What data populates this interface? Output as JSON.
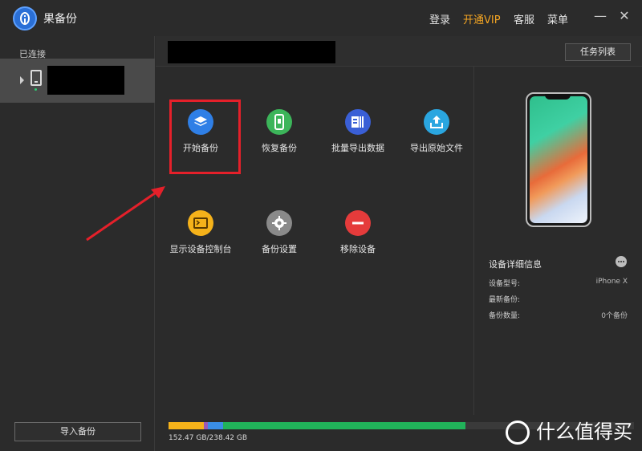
{
  "app": {
    "title": "果备份"
  },
  "topmenu": {
    "login": "登录",
    "vip": "开通VIP",
    "service": "客服",
    "menu": "菜单"
  },
  "sidebar": {
    "heading": "已连接",
    "import_label": "导入备份"
  },
  "header": {
    "task_list_label": "任务列表"
  },
  "functions": [
    {
      "label": "开始备份",
      "icon": "layers-icon",
      "color": "#2f7fe6"
    },
    {
      "label": "恢复备份",
      "icon": "phone-restore-icon",
      "color": "#3cb55a"
    },
    {
      "label": "批量导出数据",
      "icon": "batch-export-icon",
      "color": "#3a5fd6"
    },
    {
      "label": "导出原始文件",
      "icon": "upload-tray-icon",
      "color": "#2aa6e0"
    },
    {
      "label": "显示设备控制台",
      "icon": "console-icon",
      "color": "#f5b21a"
    },
    {
      "label": "备份设置",
      "icon": "gear-icon",
      "color": "#8a8a8a"
    },
    {
      "label": "移除设备",
      "icon": "minus-icon",
      "color": "#e53b3b"
    }
  ],
  "details": {
    "title": "设备详细信息",
    "rows": [
      {
        "label": "设备型号:",
        "value": "iPhone X"
      },
      {
        "label": "最新备份:",
        "value": ""
      },
      {
        "label": "备份数量:",
        "value": "0个备份"
      }
    ]
  },
  "storage": {
    "text": "152.47 GB/238.42 GB",
    "used_fraction": 0.639,
    "segments": [
      {
        "fraction": 0.075,
        "color": "#f5b21a"
      },
      {
        "fraction": 0.01,
        "color": "#9b59b6"
      },
      {
        "fraction": 0.033,
        "color": "#3a8ee6"
      },
      {
        "fraction": 0.521,
        "color": "#21b35a"
      }
    ]
  },
  "watermark": {
    "text": "什么值得买"
  },
  "colors": {
    "accent_vip": "#f5a623",
    "highlight": "#e5202a"
  }
}
